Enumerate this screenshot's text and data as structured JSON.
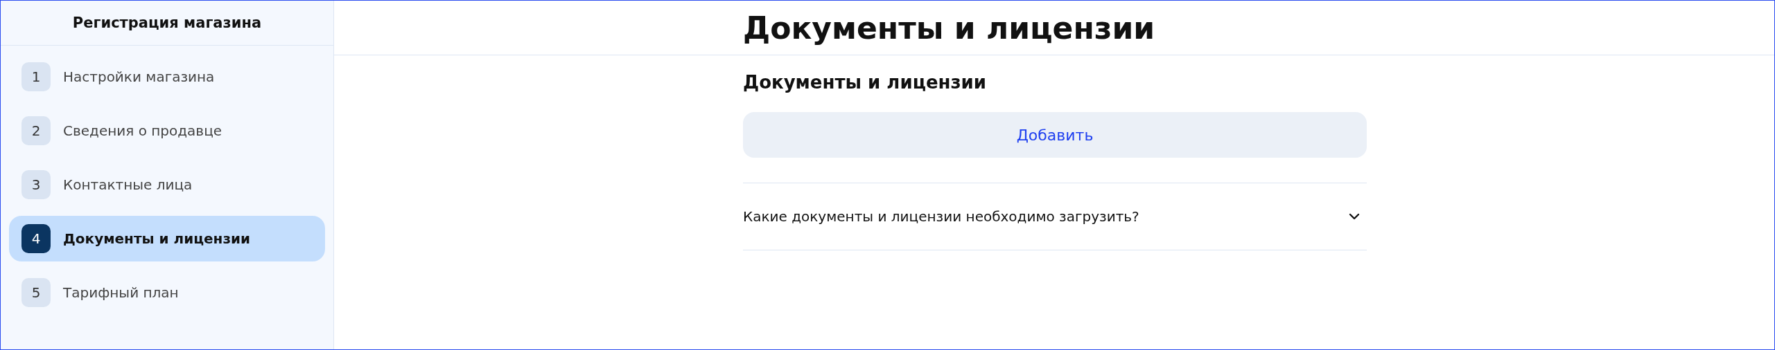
{
  "sidebar": {
    "title": "Регистрация магазина",
    "steps": [
      {
        "number": "1",
        "label": "Настройки магазина",
        "selected": false
      },
      {
        "number": "2",
        "label": "Сведения о продавце",
        "selected": false
      },
      {
        "number": "3",
        "label": "Контактные лица",
        "selected": false
      },
      {
        "number": "4",
        "label": "Документы и лицензии",
        "selected": true
      },
      {
        "number": "5",
        "label": "Тарифный план",
        "selected": false
      }
    ]
  },
  "header": {
    "title": "Документы и лицензии"
  },
  "section": {
    "title": "Документы и лицензии",
    "add_button": "Добавить",
    "faq": [
      {
        "question": "Какие документы и лицензии необходимо загрузить?",
        "expanded": false
      }
    ]
  }
}
